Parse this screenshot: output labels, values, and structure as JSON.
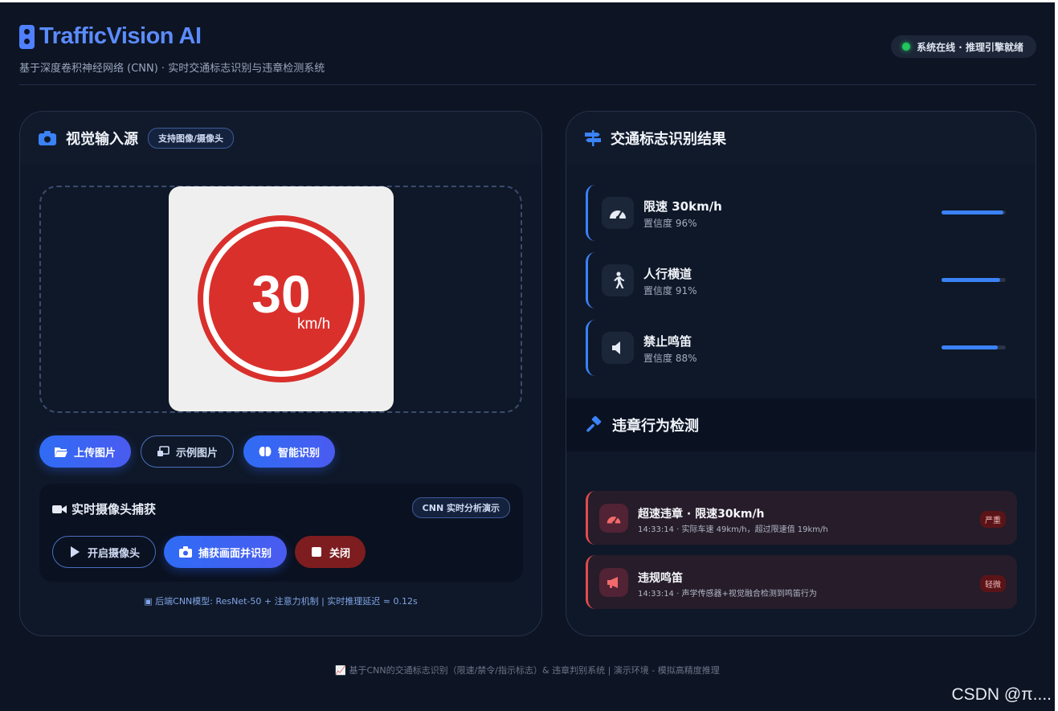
{
  "header": {
    "title": "TrafficVision AI",
    "subtitle": "基于深度卷积神经网络 (CNN) · 实时交通标志识别与违章检测系统",
    "status": "系统在线 · 推理引擎就绪",
    "icons": {
      "logo": "traffic-light-icon",
      "status": "status-dot"
    }
  },
  "input_panel": {
    "title": "视觉输入源",
    "tag": "支持图像/摄像头",
    "sign": {
      "number": "30",
      "unit": "km/h"
    },
    "buttons": {
      "upload": "上传图片",
      "example": "示例图片",
      "recognize": "智能识别"
    },
    "camera": {
      "title": "实时摄像头捕获",
      "tag": "CNN 实时分析演示",
      "start": "开启摄像头",
      "capture": "捕获画面并识别",
      "close": "关闭"
    },
    "footnote": "后端CNN模型: ResNet-50 + 注意力机制 | 实时推理延迟 ≈ 0.12s"
  },
  "results_panel": {
    "title": "交通标志识别结果",
    "items": [
      {
        "name": "限速 30km/h",
        "confidence_text": "置信度 96%",
        "confidence": 96,
        "icon": "speedometer-icon"
      },
      {
        "name": "人行横道",
        "confidence_text": "置信度 91%",
        "confidence": 91,
        "icon": "pedestrian-icon"
      },
      {
        "name": "禁止鸣笛",
        "confidence_text": "置信度 88%",
        "confidence": 88,
        "icon": "speaker-icon"
      }
    ]
  },
  "violations_panel": {
    "title": "违章行为检测",
    "items": [
      {
        "title": "超速违章 · 限速30km/h",
        "desc": "14:33:14 · 实际车速 49km/h，超过限速值 19km/h",
        "severity": "严重",
        "icon": "speedometer-icon"
      },
      {
        "title": "违规鸣笛",
        "desc": "14:33:14 · 声学传感器+视觉融合检测到鸣笛行为",
        "severity": "轻微",
        "icon": "megaphone-icon"
      }
    ]
  },
  "footer": "基于CNN的交通标志识别（限速/禁令/指示标志）& 违章判别系统 | 演示环境 - 模拟高精度推理",
  "watermark": "CSDN @π....",
  "colors": {
    "accent": "#3b82f6",
    "danger": "#e24b4b",
    "background": "#0d1423"
  }
}
